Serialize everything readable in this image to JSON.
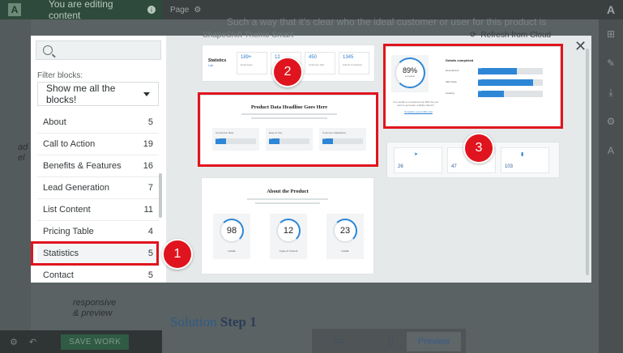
{
  "editor": {
    "top_notice": "You are editing content",
    "page_label": "Page",
    "bg_text_top": "Such a way that it's clear who the ideal customer or user for this product is",
    "bg_hand_1": "ad\nel",
    "bg_hand_2": "responsive\n& preview",
    "save_label": "SAVE WORK",
    "heading_blue": "Solution",
    "heading_rest": " Step 1",
    "preview_label": "Preview"
  },
  "modal": {
    "title": "ShapeShift Theme Smart",
    "refresh_label": "Refresh from Cloud",
    "search_placeholder": "",
    "filter_label": "Filter blocks:",
    "filter_value": "Show me all the blocks!",
    "categories": [
      {
        "label": "About",
        "count": "5"
      },
      {
        "label": "Call to Action",
        "count": "19"
      },
      {
        "label": "Benefits & Features",
        "count": "16"
      },
      {
        "label": "Lead Generation",
        "count": "7"
      },
      {
        "label": "List Content",
        "count": "11"
      },
      {
        "label": "Pricing Table",
        "count": "4"
      },
      {
        "label": "Statistics",
        "count": "5"
      },
      {
        "label": "Contact",
        "count": "5"
      }
    ]
  },
  "cards": {
    "stats_row": {
      "label": "Statistics",
      "sub": "Lab",
      "items": [
        {
          "num": "189+",
          "text": "Employees"
        },
        {
          "num": "12",
          "text": "Projects"
        },
        {
          "num": "450",
          "text": "Customer Hits"
        },
        {
          "num": "1345",
          "text": "Clients Contacted"
        }
      ]
    },
    "product_data": {
      "headline": "Product Data Headline Goes Here",
      "boxes": [
        {
          "label": "Conversion Rate",
          "fill": "10%"
        },
        {
          "label": "Ease of Use",
          "fill": "30%"
        },
        {
          "label": "Customer Satisfaction",
          "fill": "50%"
        }
      ]
    },
    "about_product": {
      "headline": "About the Product",
      "rings": [
        {
          "num": "98",
          "label": "Installs"
        },
        {
          "num": "12",
          "label": "Types of Content"
        },
        {
          "num": "23",
          "label": "Installs"
        }
      ]
    },
    "details": {
      "percent": "89%",
      "percent_sub": "complete",
      "title": "Details completed",
      "rows": [
        {
          "label": "Descriptions",
          "fill": "10%",
          "value": 0.6
        },
        {
          "label": "SEO Data",
          "fill": "30%",
          "value": 0.85
        },
        {
          "label": "Grading",
          "fill": "50%",
          "value": 0.4
        }
      ],
      "caption": "Your profile is completed only 89% Do you want to get better visibility effects?",
      "link": "Complete your profile now"
    },
    "tiles": [
      {
        "num": "26"
      },
      {
        "num": "47"
      },
      {
        "num": "103"
      }
    ]
  },
  "annotations": [
    {
      "num": "1"
    },
    {
      "num": "2"
    },
    {
      "num": "3"
    }
  ],
  "colors": {
    "highlight": "#e0141e",
    "accent_blue": "#2e86d6"
  }
}
